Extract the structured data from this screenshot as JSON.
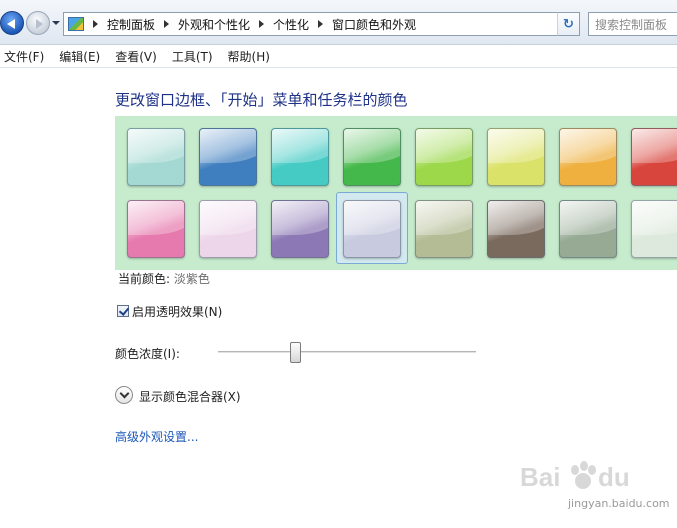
{
  "breadcrumb": {
    "items": [
      "控制面板",
      "外观和个性化",
      "个性化",
      "窗口颜色和外观"
    ]
  },
  "search": {
    "placeholder": "搜索控制面板"
  },
  "menubar": {
    "items": [
      "文件(F)",
      "编辑(E)",
      "查看(V)",
      "工具(T)",
      "帮助(H)"
    ]
  },
  "main": {
    "title": "更改窗口边框、「开始」菜单和任务栏的颜色",
    "palette_background": "#c6ebcd",
    "swatches": [
      {
        "color": "#a3d9d2"
      },
      {
        "color": "#3f7fbf"
      },
      {
        "color": "#45cbc4"
      },
      {
        "color": "#44b84a"
      },
      {
        "color": "#9cd84a"
      },
      {
        "color": "#dbe26a"
      },
      {
        "color": "#efb040"
      },
      {
        "color": "#d8453c"
      },
      {
        "color": "#e67aae"
      },
      {
        "color": "#eed6ea"
      },
      {
        "color": "#8c78b4"
      },
      {
        "color": "#c8cbe0"
      },
      {
        "color": "#b3bc94"
      },
      {
        "color": "#7a6a5e"
      },
      {
        "color": "#96aa94"
      },
      {
        "color": "#dde9dc"
      }
    ],
    "selected_index": 11,
    "current_color_label": "当前颜色:",
    "current_color_value": "淡紫色",
    "transparency_checkbox": {
      "label": "启用透明效果(N)",
      "checked": true
    },
    "intensity": {
      "label": "颜色浓度(I):",
      "value_fraction": 0.3
    },
    "mixer_toggle_label": "显示颜色混合器(X)",
    "advanced_link": "高级外观设置..."
  },
  "watermark": {
    "logo": "Baidu经验",
    "site": "jingyan.baidu.com"
  },
  "accent_color": "#1e3287",
  "link_color": "#1a57b8"
}
